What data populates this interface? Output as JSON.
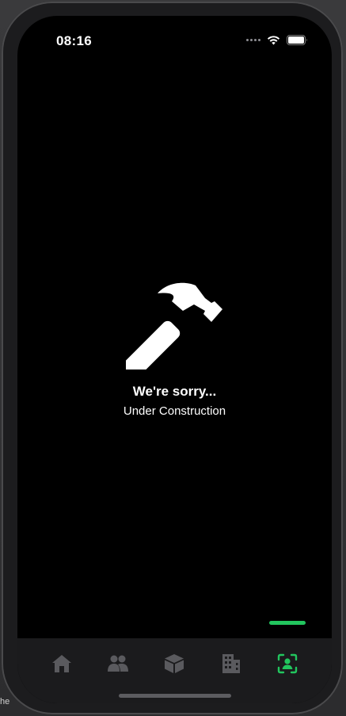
{
  "status_bar": {
    "time": "08:16",
    "icons": [
      "cellular-dots-icon",
      "wifi-icon",
      "battery-icon"
    ]
  },
  "message": {
    "icon": "hammer-icon",
    "title": "We're sorry...",
    "subtitle": "Under Construction"
  },
  "tab_bar": {
    "items": [
      {
        "icon": "home-icon",
        "active": false
      },
      {
        "icon": "users-icon",
        "active": false
      },
      {
        "icon": "box-icon",
        "active": false
      },
      {
        "icon": "building-icon",
        "active": false
      },
      {
        "icon": "profile-scan-icon",
        "active": true
      }
    ]
  },
  "background": {
    "fragment_text": "he"
  },
  "colors": {
    "accent": "#22c55e",
    "tab_inactive": "#5a5a5e",
    "screen_background": "#000000",
    "tab_bar_background": "#1b1b1d"
  }
}
